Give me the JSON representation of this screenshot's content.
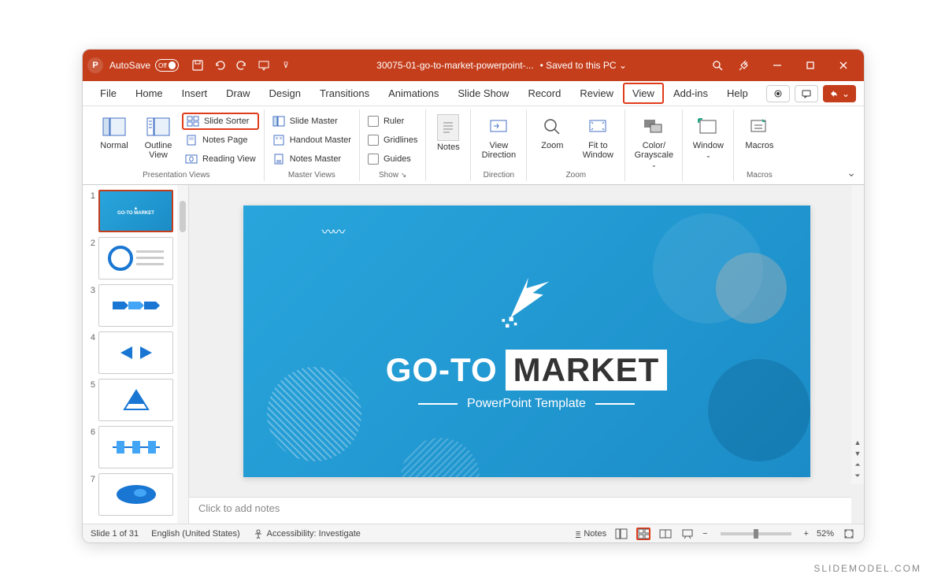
{
  "titlebar": {
    "autosave_label": "AutoSave",
    "autosave_state": "Off",
    "doc_title": "30075-01-go-to-market-powerpoint-...",
    "save_state": "Saved to this PC"
  },
  "menu": {
    "items": [
      "File",
      "Home",
      "Insert",
      "Draw",
      "Design",
      "Transitions",
      "Animations",
      "Slide Show",
      "Record",
      "Review",
      "View",
      "Add-ins",
      "Help"
    ],
    "active": "View"
  },
  "ribbon": {
    "presentation_views": {
      "label": "Presentation Views",
      "normal": "Normal",
      "outline": "Outline View",
      "slide_sorter": "Slide Sorter",
      "notes_page": "Notes Page",
      "reading_view": "Reading View"
    },
    "master_views": {
      "label": "Master Views",
      "slide_master": "Slide Master",
      "handout_master": "Handout Master",
      "notes_master": "Notes Master"
    },
    "show": {
      "label": "Show",
      "ruler": "Ruler",
      "gridlines": "Gridlines",
      "guides": "Guides"
    },
    "notes_btn": "Notes",
    "direction": {
      "label": "Direction",
      "view_direction": "View Direction"
    },
    "zoom_group": {
      "label": "Zoom",
      "zoom": "Zoom",
      "fit": "Fit to Window"
    },
    "color": {
      "label": "Color/ Grayscale"
    },
    "window": {
      "label": "Window"
    },
    "macros": {
      "label": "Macros",
      "btn": "Macros"
    }
  },
  "thumbs": {
    "count": 7
  },
  "slide": {
    "title_left": "GO-TO",
    "title_right": "MARKET",
    "subtitle": "PowerPoint Template"
  },
  "notes": {
    "placeholder": "Click to add notes"
  },
  "status": {
    "slide_info": "Slide 1 of 31",
    "language": "English (United States)",
    "accessibility": "Accessibility: Investigate",
    "notes_btn": "Notes",
    "zoom": "52%"
  },
  "watermark": "SLIDEMODEL.COM"
}
